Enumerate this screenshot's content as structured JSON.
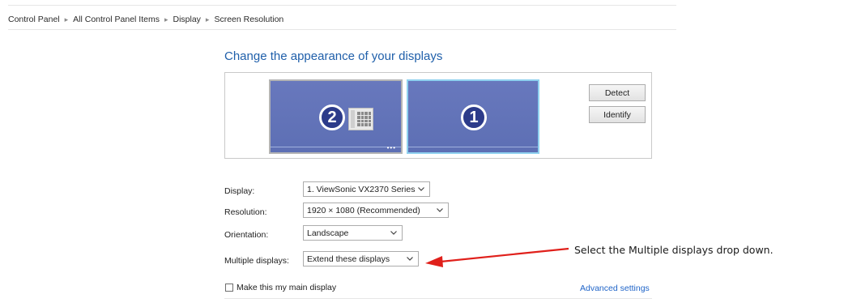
{
  "breadcrumb": {
    "items": [
      "Control Panel",
      "All Control Panel Items",
      "Display",
      "Screen Resolution"
    ],
    "separator": "▸"
  },
  "page": {
    "title": "Change the appearance of your displays"
  },
  "monitors": [
    {
      "number": "2",
      "icon": "keypad-icon",
      "selected": false
    },
    {
      "number": "1",
      "selected": true
    }
  ],
  "buttons": {
    "detect": "Detect",
    "identify": "Identify"
  },
  "form": {
    "display_label": "Display:",
    "display_value": "1. ViewSonic VX2370 Series",
    "resolution_label": "Resolution:",
    "resolution_value": "1920 × 1080 (Recommended)",
    "orientation_label": "Orientation:",
    "orientation_value": "Landscape",
    "multiple_label": "Multiple displays:",
    "multiple_value": "Extend these displays"
  },
  "main_display": {
    "label": "Make this my main display",
    "checked": false
  },
  "advanced_link": "Advanced settings",
  "annotation": {
    "text": "Select the Multiple displays drop down.",
    "arrow_color": "#e0201b"
  },
  "colors": {
    "title": "#1f5faa",
    "link": "#1f64c8",
    "monitor_fill": "#6373b9",
    "monitor_badge": "#2c3b8a",
    "selected_border": "#8fd1ef"
  }
}
